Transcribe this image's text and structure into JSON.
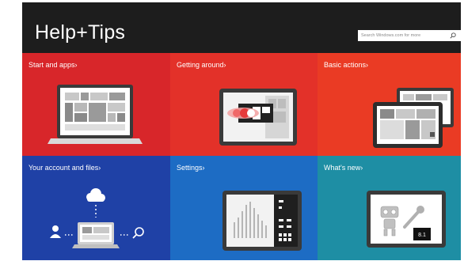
{
  "window": {
    "title": "Help+Tips"
  },
  "search": {
    "placeholder": "Search Windows.com for more"
  },
  "tiles": [
    {
      "label": "Start and apps",
      "color": "#d8262a"
    },
    {
      "label": "Getting around",
      "color": "#e33129"
    },
    {
      "label": "Basic actions",
      "color": "#ea3b24"
    },
    {
      "label": "Your account and files",
      "color": "#1f41a6"
    },
    {
      "label": "Settings",
      "color": "#1d6cc4"
    },
    {
      "label": "What's new",
      "color": "#1e8ea4"
    }
  ],
  "whats_new": {
    "badge": "8.1"
  },
  "icons": [
    "search-icon",
    "cloud-icon",
    "person-icon",
    "search-icon"
  ]
}
